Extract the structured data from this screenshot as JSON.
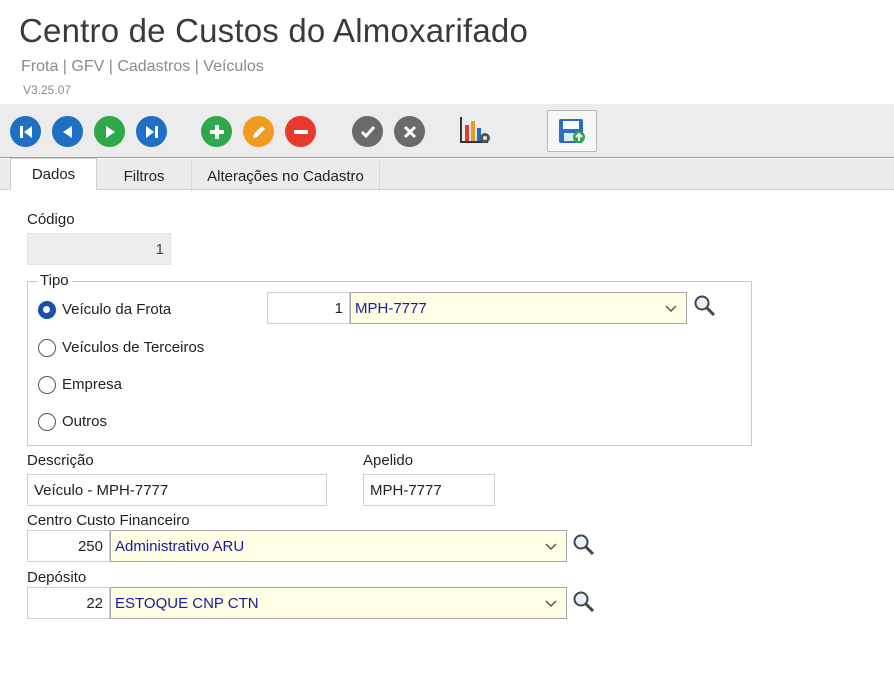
{
  "header": {
    "title": "Centro de Custos do Almoxarifado",
    "breadcrumb": "Frota | GFV | Cadastros | Veículos",
    "version": "V3.25.07"
  },
  "toolbar": {
    "buttons": [
      "first-icon",
      "prev-icon",
      "next-icon",
      "last-icon",
      "add-icon",
      "edit-icon",
      "delete-icon",
      "confirm-icon",
      "cancel-icon",
      "chart-settings-icon",
      "save-icon"
    ]
  },
  "tabs": [
    {
      "label": "Dados"
    },
    {
      "label": "Filtros"
    },
    {
      "label": "Alterações no Cadastro"
    }
  ],
  "form": {
    "codigo_label": "Código",
    "codigo_value": "1",
    "tipo_legend": "Tipo",
    "tipo_options": [
      {
        "label": "Veículo da Frota",
        "checked": true
      },
      {
        "label": "Veículos de Terceiros",
        "checked": false
      },
      {
        "label": "Empresa",
        "checked": false
      },
      {
        "label": "Outros",
        "checked": false
      }
    ],
    "veiculo_code": "1",
    "veiculo_selected": "MPH-7777",
    "descricao_label": "Descrição",
    "descricao_value": "Veículo - MPH-7777",
    "apelido_label": "Apelido",
    "apelido_value": "MPH-7777",
    "ccf_label": "Centro Custo Financeiro",
    "ccf_code": "250",
    "ccf_selected": "Administrativo ARU",
    "deposito_label": "Depósito",
    "deposito_code": "22",
    "deposito_selected": "ESTOQUE CNP CTN"
  },
  "colors": {
    "nav_blue": "#1f6fc4",
    "add_green": "#2ea84a",
    "edit_orange": "#f29a1f",
    "delete_red": "#e63b2a",
    "neutral_gray": "#6a6a6a",
    "combo_bg": "#fffde3",
    "combo_text": "#1a1aa0"
  }
}
